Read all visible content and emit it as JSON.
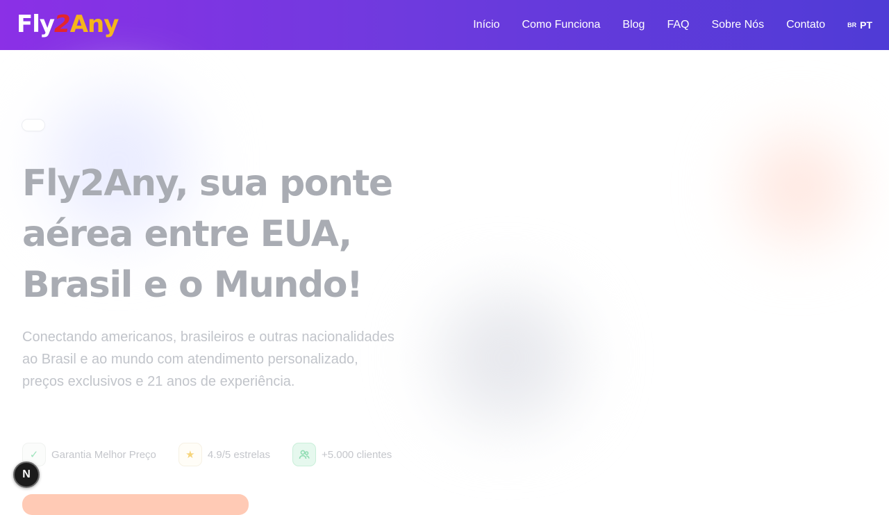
{
  "brand": {
    "logo_part1": "Fly",
    "logo_part2": "2",
    "logo_part3": "Any",
    "colors": {
      "white": "#ffffff",
      "red": "#e3262d",
      "yellow": "#f5b51b"
    }
  },
  "nav": {
    "items": [
      "Início",
      "Como Funciona",
      "Blog",
      "FAQ",
      "Sobre Nós",
      "Contato"
    ],
    "lang_flag": "BR",
    "lang_code": "PT"
  },
  "hero": {
    "headline_line1": "Fly2Any, sua ponte",
    "headline_line2": "aérea entre EUA,",
    "headline_line3": "Brasil e o Mundo!",
    "subtitle": "Conectando americanos, brasileiros e outras nacionalidades ao Brasil e ao mundo com atendimento personalizado, preços exclusivos e 21 anos de experiência.",
    "badges": [
      {
        "icon": "check-icon",
        "label": "Garantia Melhor Preço"
      },
      {
        "icon": "star-icon",
        "label": "4.9/5 estrelas"
      },
      {
        "icon": "users-icon",
        "label": "+5.000 clientes"
      }
    ]
  },
  "dev_badge": {
    "letter": "N"
  },
  "theme": {
    "header_gradient": [
      "#8b30e6",
      "#6f3ade",
      "#4f3bd6"
    ],
    "cta_color": "#ffcab5"
  }
}
